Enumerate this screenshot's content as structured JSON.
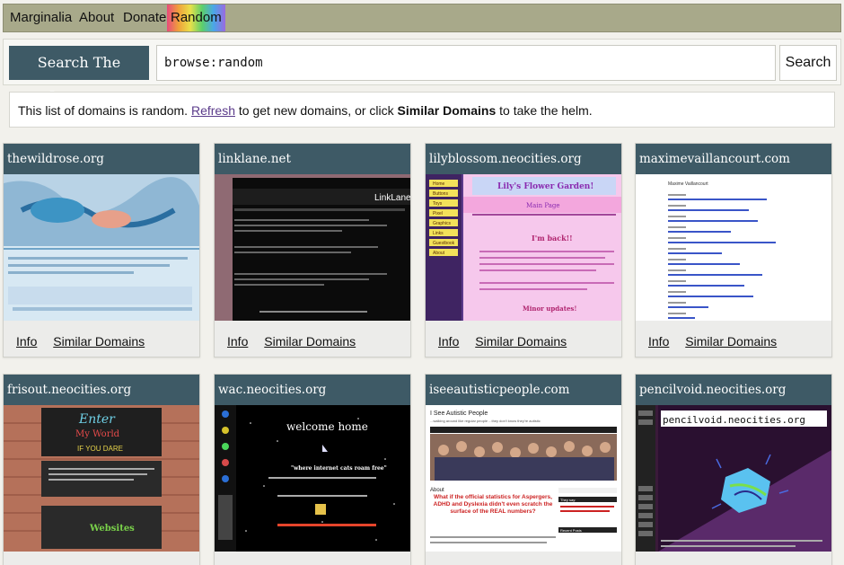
{
  "nav": {
    "items": [
      {
        "label": "Marginalia"
      },
      {
        "label": "About"
      },
      {
        "label": "Donate"
      },
      {
        "label": "Random"
      }
    ]
  },
  "search": {
    "label": "Search The Internet",
    "query": "browse:random",
    "button": "Search"
  },
  "notice": {
    "text_before": "This list of domains is random.",
    "refresh_link": "Refresh",
    "text_middle": "to get new domains, or click",
    "similar_bold": "Similar Domains",
    "text_after": "to take the helm."
  },
  "card_links": {
    "info": "Info",
    "similar": "Similar Domains"
  },
  "domains": [
    {
      "name": "thewildrose.org"
    },
    {
      "name": "linklane.net"
    },
    {
      "name": "lilyblossom.neocities.org"
    },
    {
      "name": "maximevaillancourt.com"
    },
    {
      "name": "frisout.neocities.org"
    },
    {
      "name": "wac.neocities.org"
    },
    {
      "name": "iseeautisticpeople.com"
    },
    {
      "name": "pencilvoid.neocities.org"
    }
  ],
  "screenshots": {
    "linklane": {
      "banner": "LinkLane."
    },
    "lilyblossom": {
      "title": "Lily's Flower Garden!",
      "subtitle": "Main Page",
      "heading": "I'm back!!",
      "footer": "Minor updates!",
      "nav": [
        "Home",
        "Buttons",
        "Toys",
        "Pixel",
        "Graphics",
        "Links",
        "Guestbook",
        "About"
      ]
    },
    "maxime": {
      "title": "Maxime Vaillancourt"
    },
    "frisout": {
      "line1": "Enter",
      "line2": "My World",
      "line3": "IF YOU DARE",
      "line4": "Websites"
    },
    "wac": {
      "title": "welcome home",
      "tagline": "\"where internet cats roam free\""
    },
    "iseeautistic": {
      "title": "I See Autistic People",
      "subtitle": "...walking around like regular people ...they don't know they're autistic",
      "about": "About",
      "headline": "What if the official statistics for Aspergers, ADHD and Dyslexia didn't even scratch the surface of the REAL numbers?",
      "they_say": "They say:",
      "recent": "Recent Posts"
    },
    "pencilvoid": {
      "title": "pencilvoid.neocities.org"
    }
  }
}
